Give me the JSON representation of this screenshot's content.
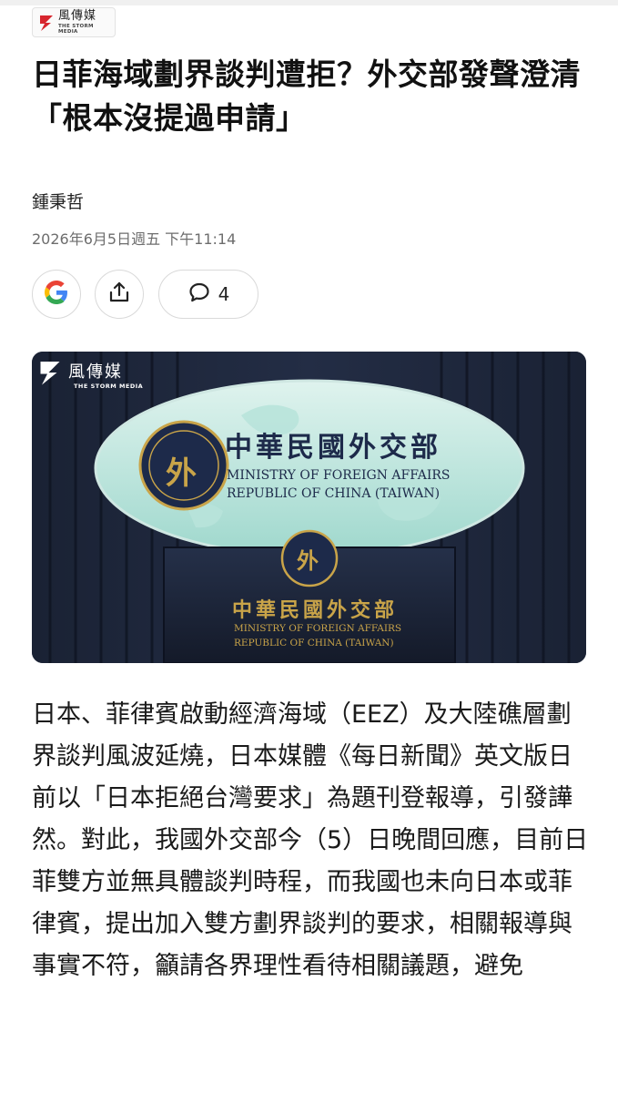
{
  "source": {
    "name_zh": "風傳媒",
    "name_en": "THE STORM MEDIA"
  },
  "article": {
    "title": "日菲海域劃界談判遭拒？外交部發聲澄清「根本沒提過申請」",
    "author": "鍾秉哲",
    "date": "2026年6月5日週五 下午11:14",
    "comment_count": "4",
    "body": "日本、菲律賓啟動經濟海域（EEZ）及大陸礁層劃界談判風波延燒，日本媒體《每日新聞》英文版日前以「日本拒絕台灣要求」為題刊登報導，引發譁然。對此，我國外交部今（5）日晚間回應，目前日菲雙方並無具體談判時程，而我國也未向日本或菲律賓，提出加入雙方劃界談判的要求，相關報導與事實不符，籲請各界理性看待相關議題，避免"
  },
  "actions": {
    "google_icon": "google-icon",
    "share_icon": "share-icon",
    "comment_icon": "comment-icon"
  },
  "hero_image": {
    "watermark_zh": "風傳媒",
    "watermark_en": "THE STORM MEDIA",
    "sign_zh": "中華民國外交部",
    "sign_en_line1": "MINISTRY OF FOREIGN AFFAIRS",
    "sign_en_line2": "REPUBLIC OF CHINA (TAIWAN)",
    "emblem_char": "外",
    "podium_zh": "中華民國外交部",
    "podium_en_line1": "MINISTRY OF FOREIGN AFFAIRS",
    "podium_en_line2": "REPUBLIC OF CHINA (TAIWAN)"
  },
  "colors": {
    "google_blue": "#4285F4",
    "google_red": "#EA4335",
    "google_yellow": "#FBBC05",
    "google_green": "#34A853",
    "brand_red": "#d7262e",
    "emblem_gold": "#c9a449",
    "emblem_navy": "#1d2a4a"
  }
}
